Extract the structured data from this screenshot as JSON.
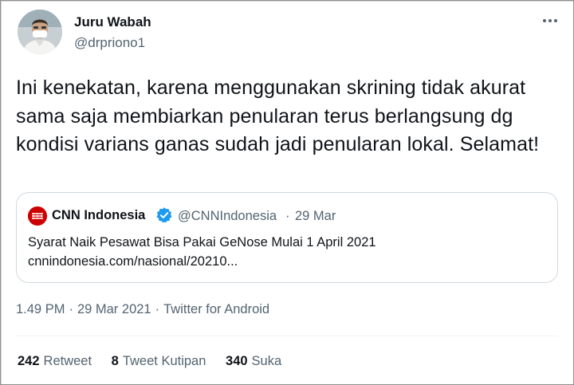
{
  "author": {
    "name": "Juru Wabah",
    "handle": "@drpriono1"
  },
  "menu": {
    "icon": "more-horizontal-icon"
  },
  "tweet": {
    "text": "Ini kenekatan, karena menggunakan skrining tidak akurat sama saja membiarkan penularan terus berlangsung dg kondisi varians ganas sudah jadi penularan lokal. Selamat!"
  },
  "quoted_tweet": {
    "name": "CNN Indonesia",
    "verified_icon": "verified-badge-icon",
    "handle": "@CNNIndonesia",
    "separator": "·",
    "date": "29 Mar",
    "text": "Syarat Naik Pesawat Bisa Pakai GeNose Mulai 1 April 2021",
    "link": "cnnindonesia.com/nasional/20210..."
  },
  "meta": {
    "time": "1.49 PM",
    "separator": "·",
    "date": "29 Mar 2021",
    "source": "Twitter for Android"
  },
  "stats": {
    "retweets_count": "242",
    "retweets_label": "Retweet",
    "quotes_count": "8",
    "quotes_label": "Tweet Kutipan",
    "likes_count": "340",
    "likes_label": "Suka"
  },
  "colors": {
    "text_primary": "#0f1419",
    "text_secondary": "#536471",
    "verified": "#1d9bf0",
    "cnn_red": "#cc0000",
    "border": "#cfd9de"
  }
}
